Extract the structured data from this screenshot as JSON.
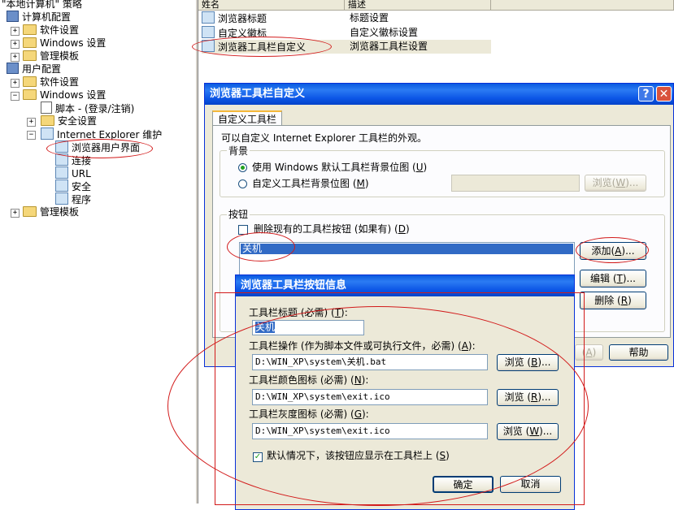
{
  "tree": {
    "root": "\"本地计算机\" 策略",
    "computer_config": "计算机配置",
    "cc_software": "软件设置",
    "cc_windows": "Windows 设置",
    "cc_admin": "管理模板",
    "user_config": "用户配置",
    "uc_software": "软件设置",
    "uc_windows": "Windows 设置",
    "uc_scripts": "脚本 - (登录/注销)",
    "uc_security": "安全设置",
    "uc_ie": "Internet Explorer 维护",
    "uc_browser_ui": "浏览器用户界面",
    "uc_connection": "连接",
    "uc_url": "URL",
    "uc_ie_security": "安全",
    "uc_programs": "程序",
    "uc_admin": "管理模板"
  },
  "list": {
    "col_name": "姓名",
    "col_desc": "描述",
    "rows": [
      {
        "name": "浏览器标题",
        "desc": "标题设置"
      },
      {
        "name": "自定义徽标",
        "desc": "自定义徽标设置"
      },
      {
        "name": "浏览器工具栏自定义",
        "desc": "浏览器工具栏设置"
      }
    ]
  },
  "dialog1": {
    "title": "浏览器工具栏自定义",
    "help_glyph": "?",
    "close_glyph": "✕",
    "tab": "自定义工具栏",
    "intro": "可以自定义 Internet Explorer 工具栏的外观。",
    "bg_group": "背景",
    "radio_default": "使用 Windows 默认工具栏背景位图",
    "radio_default_key": "U",
    "radio_custom": "自定义工具栏背景位图",
    "radio_custom_key": "M",
    "browse_w_label": "浏览",
    "browse_w_key": "W",
    "buttons_group": "按钮",
    "remove_existing": "删除现有的工具栏按钮 (如果有)",
    "remove_key": "D",
    "toolbar_buttons": [
      "关机"
    ],
    "add_label": "添加",
    "add_key": "A",
    "edit_label": "编辑",
    "edit_key": "T",
    "delete_label": "删除",
    "delete_key": "R",
    "help_btn": "帮助",
    "hidden_key": "A"
  },
  "dialog2": {
    "title": "浏览器工具栏按钮信息",
    "caption_label": "工具栏标题 (必需)",
    "caption_key": "T",
    "caption_value": "关机",
    "action_label": "工具栏操作 (作为脚本文件或可执行文件，必需)",
    "action_key": "A",
    "action_value": "D:\\WIN_XP\\system\\关机.bat",
    "browse_b": "浏览",
    "browse_b_key": "B",
    "color_label": "工具栏颜色图标 (必需)",
    "color_key": "N",
    "color_value": "D:\\WIN_XP\\system\\exit.ico",
    "browse_r": "浏览",
    "browse_r_key": "R",
    "gray_label": "工具栏灰度图标 (必需)",
    "gray_key": "G",
    "gray_value": "D:\\WIN_XP\\system\\exit.ico",
    "browse_w": "浏览",
    "browse_w_key": "W",
    "default_show": "默认情况下，该按钮应显示在工具栏上",
    "default_show_key": "S",
    "ok": "确定",
    "cancel": "取消"
  },
  "colors": {
    "title_blue": "#0a5ae0",
    "annotation_red": "#d21a1a",
    "dialog_face": "#ece9d8",
    "selection": "#316ac5"
  }
}
